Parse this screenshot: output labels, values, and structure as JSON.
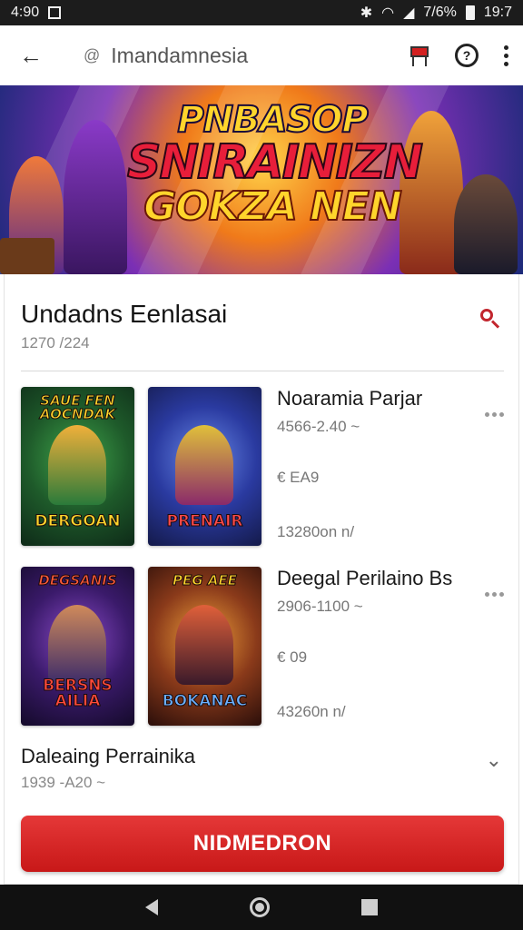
{
  "status": {
    "time": "4:90",
    "battery": "7/6%",
    "right_time": "19:7"
  },
  "topbar": {
    "title": "Imandamnesia",
    "title_prefix": "@"
  },
  "banner": {
    "line1": "PNBASOP",
    "line2": "SNIRAINIZN",
    "line3": "GOKZA NEN"
  },
  "section": {
    "heading": "Undadns Eenlasai",
    "date": "1270 /224"
  },
  "items": [
    {
      "name": "Noaramia Parjar",
      "range": "4566-2.40 ~",
      "size": "€ EA9",
      "count": "13280on n/",
      "thumbs": [
        {
          "top_text": "SAUE FEN AOCNDAK",
          "bottom_text": "DERGOAN"
        },
        {
          "top_text": "",
          "bottom_text": "PRENAIR"
        }
      ]
    },
    {
      "name": "Deegal Perilaino Bs",
      "range": "2906-1100 ~",
      "size": "€ 09",
      "count": "43260n n/",
      "thumbs": [
        {
          "top_text": "DEGSANIS",
          "bottom_text": "BERSNS AILIA"
        },
        {
          "top_text": "PEG AEE",
          "bottom_text": "BOKANAC"
        }
      ]
    }
  ],
  "footer": {
    "title": "Daleaing Perrainika",
    "date": "1939 -A20 ~"
  },
  "cta": {
    "label": "NIDMEDRON"
  },
  "colors": {
    "accent": "#d32020",
    "cta": "#d42626"
  }
}
